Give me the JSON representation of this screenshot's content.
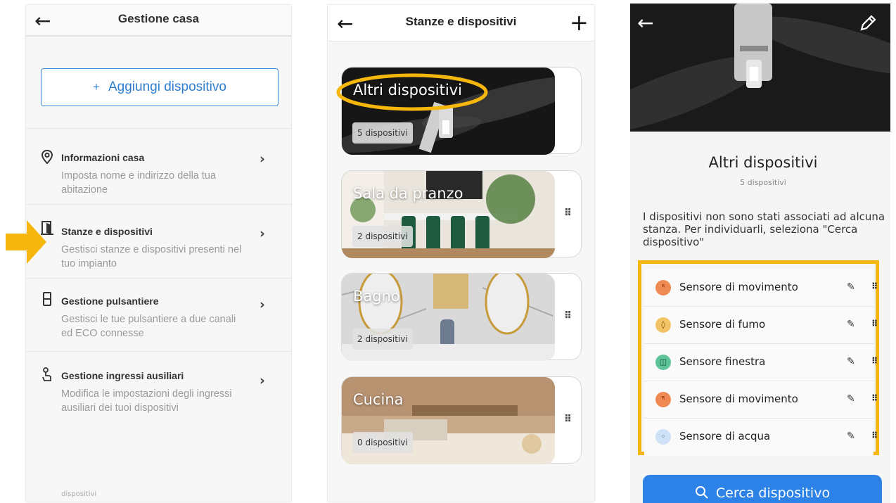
{
  "screen1": {
    "title": "Gestione casa",
    "back_icon": "arrow-left-icon",
    "add_button": {
      "plus": "+",
      "label": "Aggiungi dispositivo"
    },
    "menu": [
      {
        "icon": "location-pin-icon",
        "title": "Informazioni casa",
        "description": "Imposta nome e indirizzo della tua abitazione"
      },
      {
        "icon": "door-icon",
        "title": "Stanze e dispositivi",
        "description": "Gestisci stanze e dispositivi presenti nel tuo impianto"
      },
      {
        "icon": "switch-panel-icon",
        "title": "Gestione pulsantiere",
        "description": "Gestisci le tue pulsantiere a due canali ed ECO connesse"
      },
      {
        "icon": "touch-hand-icon",
        "title": "Gestione ingressi ausiliari",
        "description": "Modifica le impostazioni degli ingressi ausiliari dei tuoi dispositivi"
      }
    ],
    "footer_fragment": "dispositivi",
    "chevron": "›"
  },
  "screen2": {
    "title": "Stanze e dispositivi",
    "back_icon": "arrow-left-icon",
    "add_icon": "plus-icon",
    "plus": "+",
    "rooms": [
      {
        "name": "Altri dispositivi",
        "count": "5 dispositivi"
      },
      {
        "name": "Sala da pranzo",
        "count": "2 dispositivi"
      },
      {
        "name": "Bagno",
        "count": "2 dispositivi"
      },
      {
        "name": "Cucina",
        "count": "0 dispositivi"
      }
    ],
    "drag": "⠿"
  },
  "screen3": {
    "title": "Altri dispositivi",
    "subtitle": "5 dispositivi",
    "description": "I dispositivi non sono stati associati ad alcuna stanza. Per individuarli, seleziona \"Cerca dispositivo\"",
    "devices": [
      {
        "name": "Sensore di movimento",
        "icon": "motion-icon",
        "glyph": "ᴿ",
        "color": "#f08a55"
      },
      {
        "name": "Sensore di fumo",
        "icon": "smoke-icon",
        "glyph": "◊",
        "color": "#f3c466"
      },
      {
        "name": "Sensore finestra",
        "icon": "window-icon",
        "glyph": "◫",
        "color": "#5fc49a"
      },
      {
        "name": "Sensore di movimento",
        "icon": "motion-icon",
        "glyph": "ᴿ",
        "color": "#f08a55"
      },
      {
        "name": "Sensore di acqua",
        "icon": "water-drop-icon",
        "glyph": "◦",
        "color": "#cfe1f7"
      }
    ],
    "pencil": "✎",
    "drag": "⠿",
    "search_button": {
      "icon": "search-icon",
      "label": "Cerca dispositivo"
    }
  },
  "highlight_color": "#f5b70c",
  "accent_color": "#2c82e6"
}
